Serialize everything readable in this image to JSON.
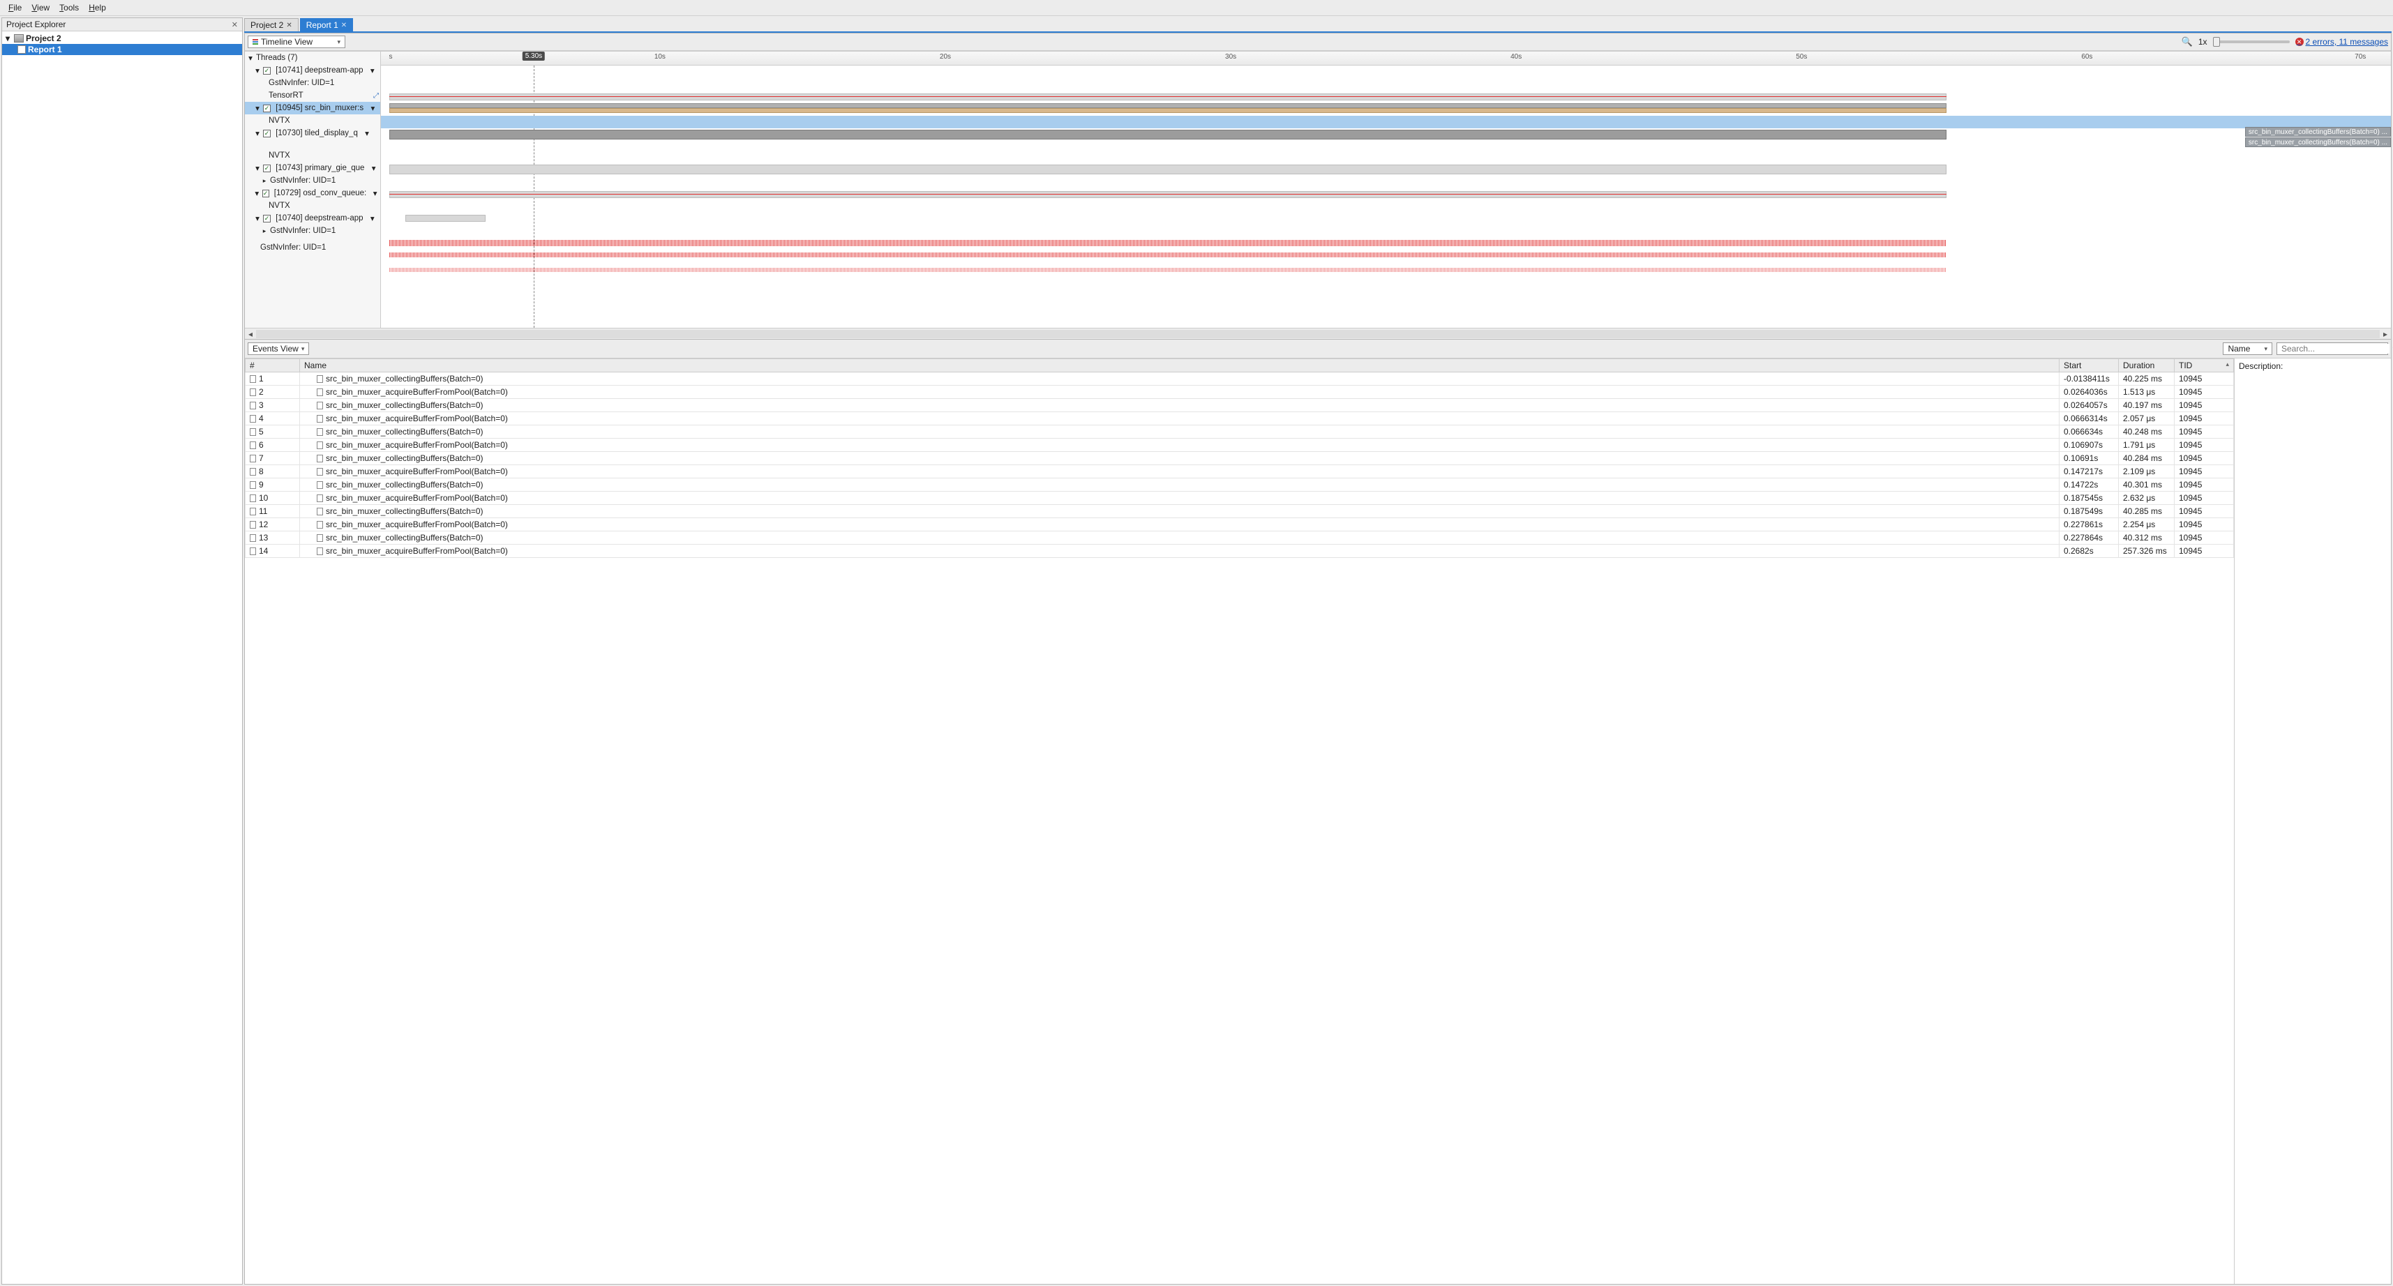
{
  "menu": {
    "file": "File",
    "view": "View",
    "tools": "Tools",
    "help": "Help"
  },
  "explorer": {
    "title": "Project Explorer",
    "project": "Project 2",
    "report": "Report 1"
  },
  "tabs": {
    "t0": "Project 2",
    "t1": "Report 1"
  },
  "timeline": {
    "view_label": "Timeline View",
    "zoom": "1x",
    "errors": "2 errors, 11 messages",
    "ruler": {
      "s": "s",
      "t10": "10s",
      "t20": "20s",
      "t30": "30s",
      "t40": "40s",
      "t50": "50s",
      "t60": "60s",
      "t70": "70s",
      "marker": "5.30s"
    },
    "tree": {
      "threads": "Threads (7)",
      "n0": "[10741] deepstream-app",
      "n0a": "GstNvInfer: UID=1",
      "n0b": "TensorRT",
      "n1": "[10945] src_bin_muxer:s",
      "n1a": "NVTX",
      "n2": "[10730] tiled_display_q",
      "n2a": "NVTX",
      "n3": "[10743] primary_gie_que",
      "n3a": "GstNvInfer: UID=1",
      "n4": "[10729] osd_conv_queue:",
      "n4a": "NVTX",
      "n5": "[10740] deepstream-app",
      "n5a": "GstNvInfer: UID=1",
      "n6": "GstNvInfer: UID=1"
    },
    "tags": {
      "a": "src_bin_muxer_collectingBuffers(Batch=0) ...",
      "b": "src_bin_muxer_collectingBuffers(Batch=0) ..."
    }
  },
  "events": {
    "view_label": "Events View",
    "filter_by": "Name",
    "search_ph": "Search...",
    "desc_label": "Description:",
    "cols": {
      "num": "#",
      "name": "Name",
      "start": "Start",
      "dur": "Duration",
      "tid": "TID"
    },
    "rows": [
      {
        "n": "1",
        "name": "src_bin_muxer_collectingBuffers(Batch=0)",
        "start": "-0.0138411s",
        "dur": "40.225 ms",
        "tid": "10945"
      },
      {
        "n": "2",
        "name": "src_bin_muxer_acquireBufferFromPool(Batch=0)",
        "start": "0.0264036s",
        "dur": "1.513 μs",
        "tid": "10945"
      },
      {
        "n": "3",
        "name": "src_bin_muxer_collectingBuffers(Batch=0)",
        "start": "0.0264057s",
        "dur": "40.197 ms",
        "tid": "10945"
      },
      {
        "n": "4",
        "name": "src_bin_muxer_acquireBufferFromPool(Batch=0)",
        "start": "0.0666314s",
        "dur": "2.057 μs",
        "tid": "10945"
      },
      {
        "n": "5",
        "name": "src_bin_muxer_collectingBuffers(Batch=0)",
        "start": "0.066634s",
        "dur": "40.248 ms",
        "tid": "10945"
      },
      {
        "n": "6",
        "name": "src_bin_muxer_acquireBufferFromPool(Batch=0)",
        "start": "0.106907s",
        "dur": "1.791 μs",
        "tid": "10945"
      },
      {
        "n": "7",
        "name": "src_bin_muxer_collectingBuffers(Batch=0)",
        "start": "0.10691s",
        "dur": "40.284 ms",
        "tid": "10945"
      },
      {
        "n": "8",
        "name": "src_bin_muxer_acquireBufferFromPool(Batch=0)",
        "start": "0.147217s",
        "dur": "2.109 μs",
        "tid": "10945"
      },
      {
        "n": "9",
        "name": "src_bin_muxer_collectingBuffers(Batch=0)",
        "start": "0.14722s",
        "dur": "40.301 ms",
        "tid": "10945"
      },
      {
        "n": "10",
        "name": "src_bin_muxer_acquireBufferFromPool(Batch=0)",
        "start": "0.187545s",
        "dur": "2.632 μs",
        "tid": "10945"
      },
      {
        "n": "11",
        "name": "src_bin_muxer_collectingBuffers(Batch=0)",
        "start": "0.187549s",
        "dur": "40.285 ms",
        "tid": "10945"
      },
      {
        "n": "12",
        "name": "src_bin_muxer_acquireBufferFromPool(Batch=0)",
        "start": "0.227861s",
        "dur": "2.254 μs",
        "tid": "10945"
      },
      {
        "n": "13",
        "name": "src_bin_muxer_collectingBuffers(Batch=0)",
        "start": "0.227864s",
        "dur": "40.312 ms",
        "tid": "10945"
      },
      {
        "n": "14",
        "name": "src_bin_muxer_acquireBufferFromPool(Batch=0)",
        "start": "0.2682s",
        "dur": "257.326 ms",
        "tid": "10945"
      }
    ]
  }
}
